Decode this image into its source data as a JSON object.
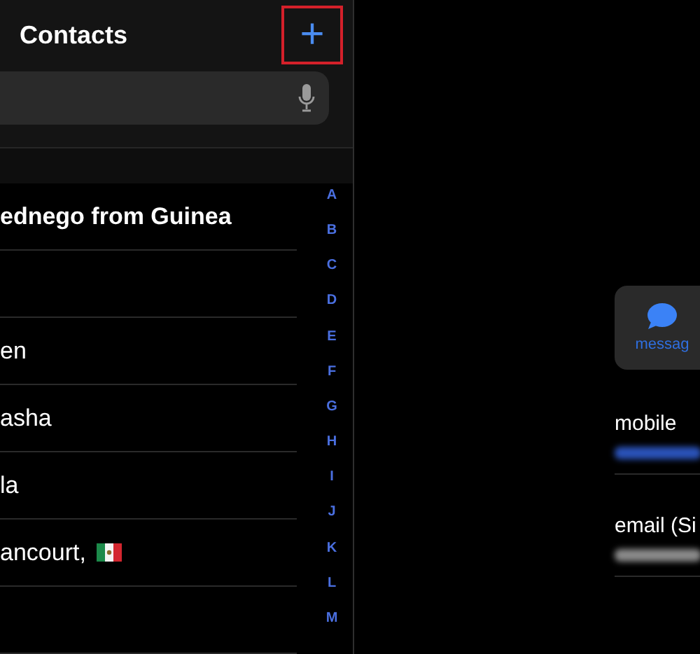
{
  "header": {
    "title": "Contacts",
    "add_button": "+"
  },
  "contacts": [
    {
      "kind": "contact",
      "name": "ednego from Guinea",
      "bold": true,
      "flag": false
    },
    {
      "kind": "blank"
    },
    {
      "kind": "contact",
      "name": "en",
      "bold": false,
      "flag": false
    },
    {
      "kind": "contact",
      "name": "asha",
      "bold": false,
      "flag": false
    },
    {
      "kind": "contact",
      "name": "la",
      "bold": false,
      "flag": false
    },
    {
      "kind": "contact",
      "name": "ancourt,",
      "bold": false,
      "flag": true
    },
    {
      "kind": "blank"
    }
  ],
  "index": [
    "A",
    "B",
    "C",
    "D",
    "E",
    "F",
    "G",
    "H",
    "I",
    "J",
    "K",
    "L",
    "M"
  ],
  "detail": {
    "action": "messag",
    "fields": [
      {
        "label": "mobile",
        "kind": "phone"
      },
      {
        "label": "email (Si",
        "kind": "email"
      }
    ]
  }
}
